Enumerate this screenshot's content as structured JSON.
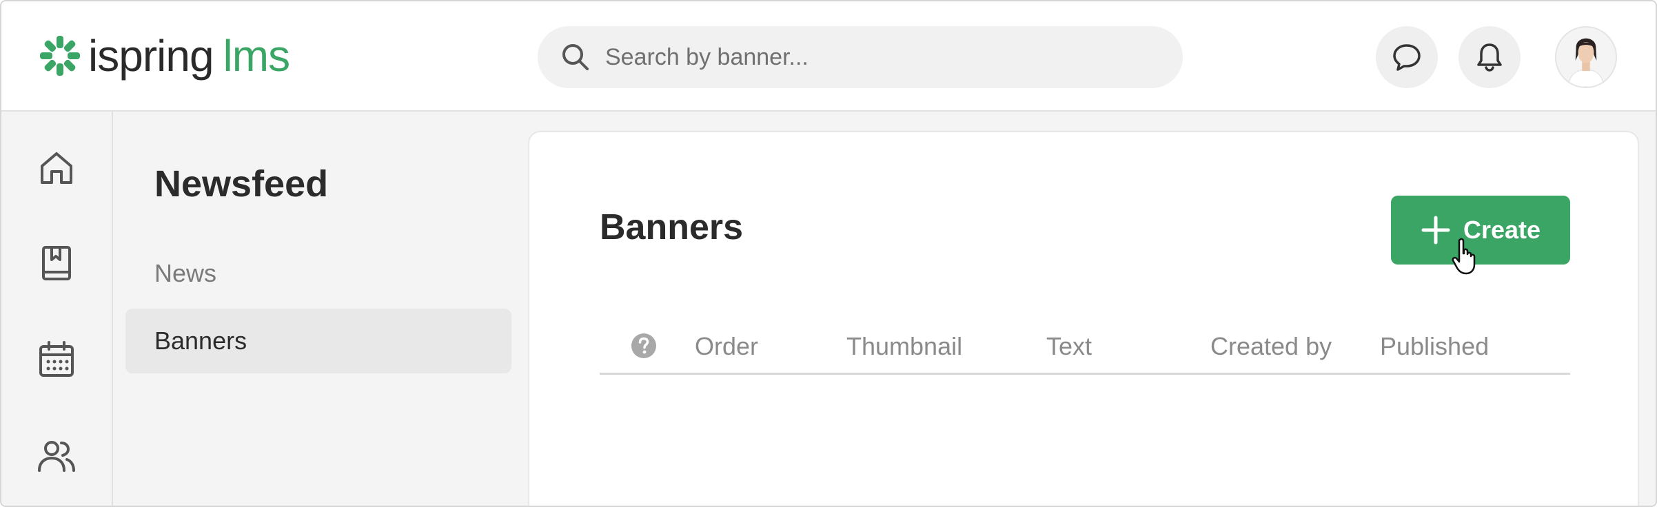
{
  "header": {
    "logo_word1": "ispring",
    "logo_word2": "lms",
    "search_placeholder": "Search by banner...",
    "brand_color": "#3aa565"
  },
  "rail": {
    "items": [
      {
        "icon": "home-icon"
      },
      {
        "icon": "book-icon"
      },
      {
        "icon": "calendar-icon"
      },
      {
        "icon": "users-icon"
      }
    ]
  },
  "subnav": {
    "title": "Newsfeed",
    "items": [
      {
        "label": "News",
        "active": false
      },
      {
        "label": "Banners",
        "active": true
      }
    ]
  },
  "main": {
    "title": "Banners",
    "create_label": "Create",
    "columns": [
      "Order",
      "Thumbnail",
      "Text",
      "Created by",
      "Published"
    ]
  }
}
